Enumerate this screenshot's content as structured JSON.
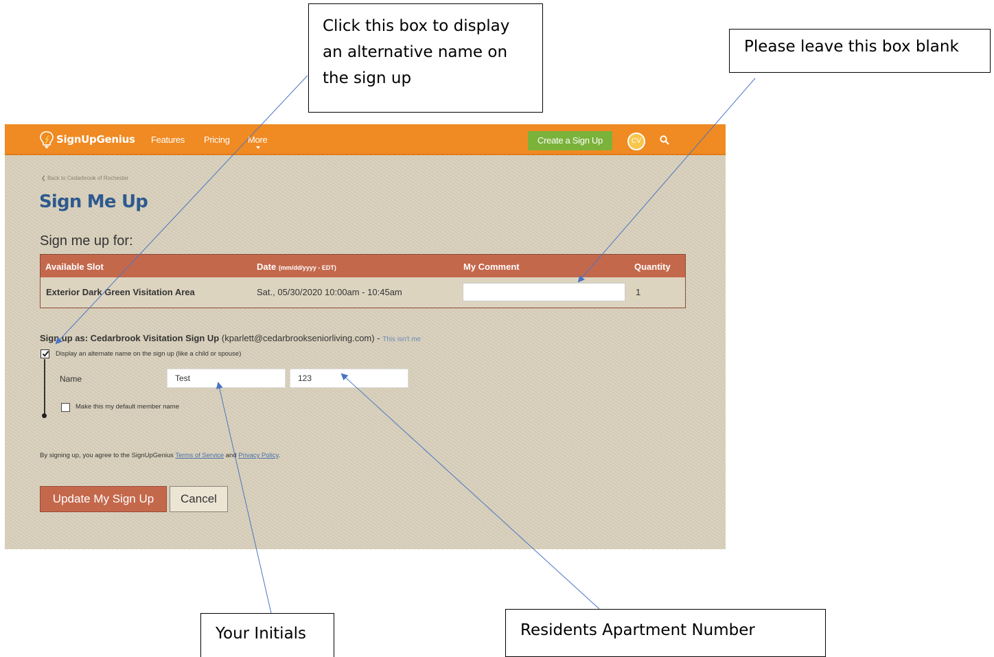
{
  "callouts": {
    "alt_name": [
      "Click this box to display",
      "an alternative name on",
      "the sign up"
    ],
    "leave_blank": "Please leave this box blank",
    "initials": "Your Initials",
    "apartment": "Residents Apartment Number"
  },
  "header": {
    "logo": "SignUpGenius",
    "nav": {
      "features": "Features",
      "pricing": "Pricing",
      "more": "More"
    },
    "create_button": "Create a Sign Up",
    "avatar": "CV"
  },
  "page": {
    "back_link": "Back to Cedarbrook of Rochester",
    "title": "Sign Me Up",
    "subtitle": "Sign me up for:"
  },
  "table": {
    "headers": {
      "slot": "Available Slot",
      "date": "Date",
      "date_note": "(mm/dd/yyyy - EDT)",
      "comment": "My Comment",
      "quantity": "Quantity"
    },
    "row": {
      "slot": "Exterior Dark Green Visitation Area",
      "date": "Sat., 05/30/2020 10:00am - 10:45am",
      "comment": "",
      "quantity": "1"
    }
  },
  "signup_as": {
    "prefix": "Sign up as: Cedarbrook Visitation Sign Up",
    "email": "(kparlett@cedarbrookseniorliving.com) -",
    "not_me": "This isn't me"
  },
  "alternate": {
    "checkbox_label": "Display an alternate name on the sign up (like a child or spouse)",
    "checked": true,
    "name_label": "Name",
    "first_name": "Test",
    "last_name": "123",
    "default_label": "Make this my default member name"
  },
  "agreement": {
    "prefix": "By signing up, you agree to the SignUpGenius",
    "terms": "Terms of Service",
    "and": "and",
    "privacy": "Privacy Policy"
  },
  "buttons": {
    "update": "Update My Sign Up",
    "cancel": "Cancel"
  },
  "colors": {
    "brand_orange": "#f08a22",
    "create_green": "#7ab23a",
    "title_blue": "#2e5a8f",
    "table_head": "#c4684c",
    "arrow": "#4a74c4"
  }
}
